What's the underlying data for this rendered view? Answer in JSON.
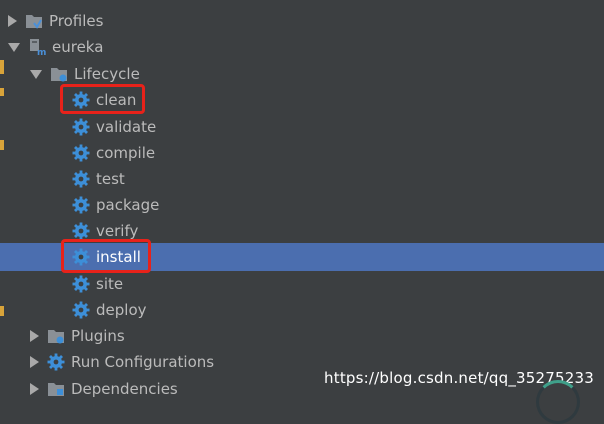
{
  "tree": {
    "profiles": {
      "label": "Profiles",
      "icon": "profiles-folder-icon"
    },
    "project": {
      "label": "eureka",
      "icon": "maven-module-icon"
    },
    "lifecycle": {
      "label": "Lifecycle",
      "icon": "lifecycle-folder-icon",
      "goals": [
        {
          "label": "clean",
          "highlighted": true
        },
        {
          "label": "validate"
        },
        {
          "label": "compile"
        },
        {
          "label": "test"
        },
        {
          "label": "package"
        },
        {
          "label": "verify"
        },
        {
          "label": "install",
          "selected": true,
          "highlighted": true
        },
        {
          "label": "site"
        },
        {
          "label": "deploy"
        }
      ]
    },
    "plugins": {
      "label": "Plugins",
      "icon": "plugins-folder-icon"
    },
    "run_configurations": {
      "label": "Run Configurations",
      "icon": "run-config-gear-icon"
    },
    "dependencies": {
      "label": "Dependencies",
      "icon": "dependencies-folder-icon"
    }
  },
  "colors": {
    "background": "#3c3f41",
    "selection": "#4b6eaf",
    "highlight_box": "#e8221a",
    "gear": "#3d8fd8"
  },
  "watermark": "https://blog.csdn.net/qq_35275233"
}
